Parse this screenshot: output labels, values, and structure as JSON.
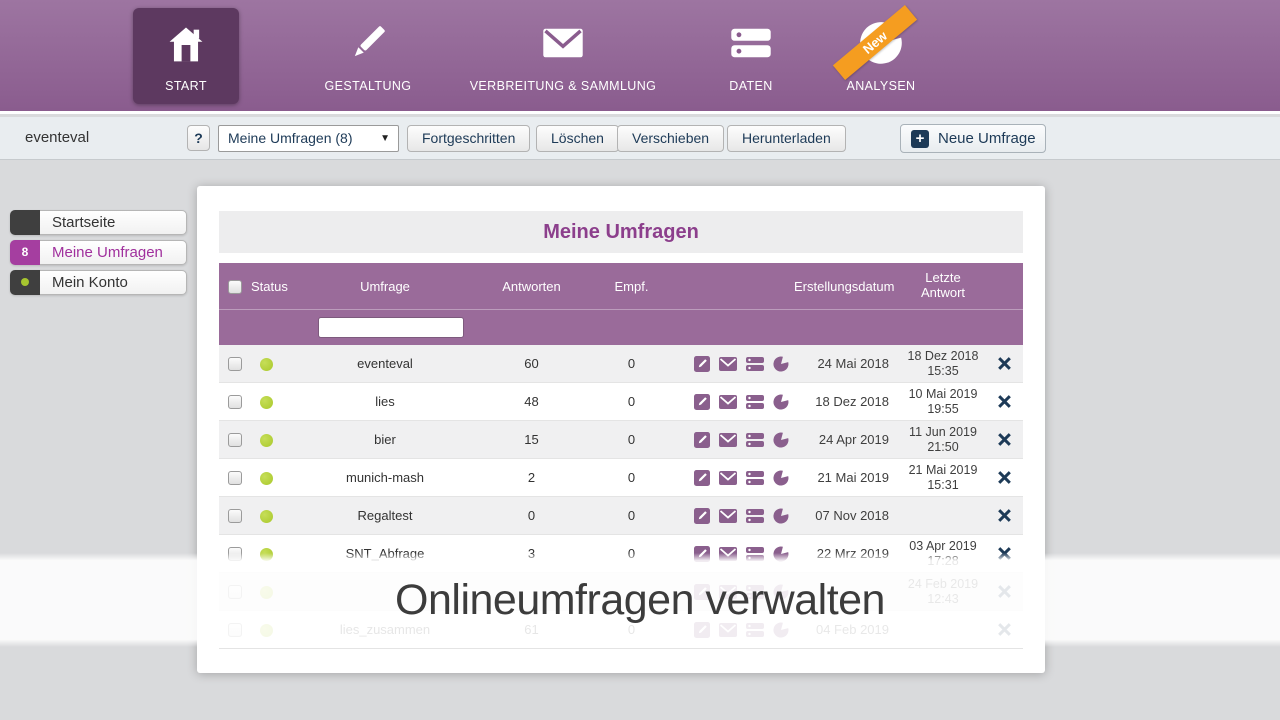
{
  "nav": {
    "items": [
      {
        "label": "START"
      },
      {
        "label": "GESTALTUNG"
      },
      {
        "label": "VERBREITUNG & SAMMLUNG"
      },
      {
        "label": "DATEN"
      },
      {
        "label": "ANALYSEN",
        "badge": "New"
      }
    ]
  },
  "toolbar": {
    "context_label": "eventeval",
    "help": "?",
    "filter_selected": "Meine Umfragen (8)",
    "btn_fortgeschritten": "Fortgeschritten",
    "btn_loeschen": "Löschen",
    "btn_verschieben": "Verschieben",
    "btn_herunterladen": "Herunterladen",
    "btn_neue_umfrage": "Neue Umfrage",
    "plus": "+"
  },
  "sidebar": {
    "startseite": "Startseite",
    "meine_umfragen": "Meine Umfragen",
    "meine_umfragen_badge": "8",
    "mein_konto": "Mein Konto"
  },
  "panel": {
    "title": "Meine Umfragen",
    "table": {
      "col_status": "Status",
      "col_umfrage": "Umfrage",
      "col_antworten": "Antworten",
      "col_empf": "Empf.",
      "col_erstellungsdatum": "Erstellungsdatum",
      "col_letzte_1": "Letzte",
      "col_letzte_2": "Antwort",
      "rows": [
        {
          "name": "eventeval",
          "antworten": "60",
          "empf": "0",
          "erstellt": "24 Mai 2018",
          "letzte_datum": "18 Dez 2018",
          "letzte_zeit": "15:35"
        },
        {
          "name": "lies",
          "antworten": "48",
          "empf": "0",
          "erstellt": "18 Dez 2018",
          "letzte_datum": "10 Mai 2019",
          "letzte_zeit": "19:55"
        },
        {
          "name": "bier",
          "antworten": "15",
          "empf": "0",
          "erstellt": "24 Apr 2019",
          "letzte_datum": "11 Jun 2019",
          "letzte_zeit": "21:50"
        },
        {
          "name": "munich-mash",
          "antworten": "2",
          "empf": "0",
          "erstellt": "21 Mai 2019",
          "letzte_datum": "21 Mai 2019",
          "letzte_zeit": "15:31"
        },
        {
          "name": "Regaltest",
          "antworten": "0",
          "empf": "0",
          "erstellt": "07 Nov 2018",
          "letzte_datum": "",
          "letzte_zeit": ""
        },
        {
          "name": "SNT_Abfrage",
          "antworten": "3",
          "empf": "0",
          "erstellt": "22 Mrz 2019",
          "letzte_datum": "03 Apr 2019",
          "letzte_zeit": "17:28"
        },
        {
          "name": "",
          "antworten": "",
          "empf": "",
          "erstellt": "",
          "letzte_datum": "24 Feb 2019",
          "letzte_zeit": "12:43"
        },
        {
          "name": "lies_zusammen",
          "antworten": "61",
          "empf": "0",
          "erstellt": "04 Feb 2019",
          "letzte_datum": "",
          "letzte_zeit": ""
        }
      ]
    }
  },
  "overlay": {
    "caption": "Onlineumfragen verwalten"
  },
  "colors": {
    "nav_gradient_top": "#9d75a1",
    "nav_gradient_bottom": "#8a5c8e",
    "nav_active_tile": "#5d3960",
    "table_header_purple": "#9a6b9a",
    "title_purple": "#8c3f8c",
    "row_icon_purple": "#8a5f8d",
    "sidebar_badge_magenta": "#a53ea0",
    "status_green": "#b4d234",
    "action_navy": "#1d3a57",
    "ribbon_orange": "#f59d20"
  }
}
